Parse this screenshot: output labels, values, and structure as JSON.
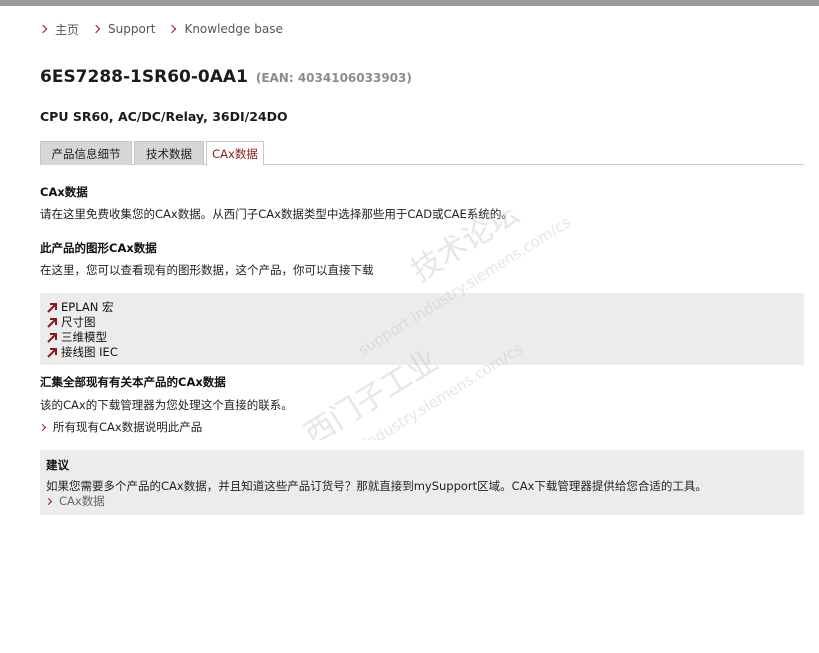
{
  "breadcrumb": [
    "主页",
    "Support",
    "Knowledge base"
  ],
  "product": {
    "title": "6ES7288-1SR60-0AA1",
    "ean": "(EAN: 4034106033903)",
    "subtitle": "CPU SR60, AC/DC/Relay, 36DI/24DO"
  },
  "tabs": [
    "产品信息细节",
    "技术数据",
    "CAx数据"
  ],
  "active_tab": "CAx数据",
  "section_cax": {
    "heading": "CAx数据",
    "text": "请在这里免费收集您的CAx数据。从西门子CAx数据类型中选择那些用于CAD或CAE系统的。"
  },
  "section_graphic": {
    "heading": "此产品的图形CAx数据",
    "text": "在这里，您可以查看现有的图形数据，这个产品，你可以直接下载"
  },
  "graphic_links": [
    "EPLAN 宏",
    "尺寸图",
    "三维模型",
    "接线图 IEC"
  ],
  "section_collect": {
    "heading": "汇集全部现有有关本产品的CAx数据",
    "text": "该的CAx的下载管理器为您处理这个直接的联系。",
    "link": "所有现有CAx数据说明此产品"
  },
  "advice": {
    "title": "建议",
    "text": "如果您需要多个产品的CAx数据，并且知道这些产品订货号？那就直接到mySupport区域。CAx下载管理器提供给您合适的工具。",
    "link": "CAx数据"
  },
  "watermark": {
    "line1": "技术论坛",
    "line2": "support.industry.siemens.com/cs",
    "line3": "西门子工业",
    "line4": "support.industry.siemens.com/cs"
  },
  "colors": {
    "accent": "#8a1a1a",
    "panel": "#ececec",
    "tab_inactive": "#d6d6d6"
  }
}
